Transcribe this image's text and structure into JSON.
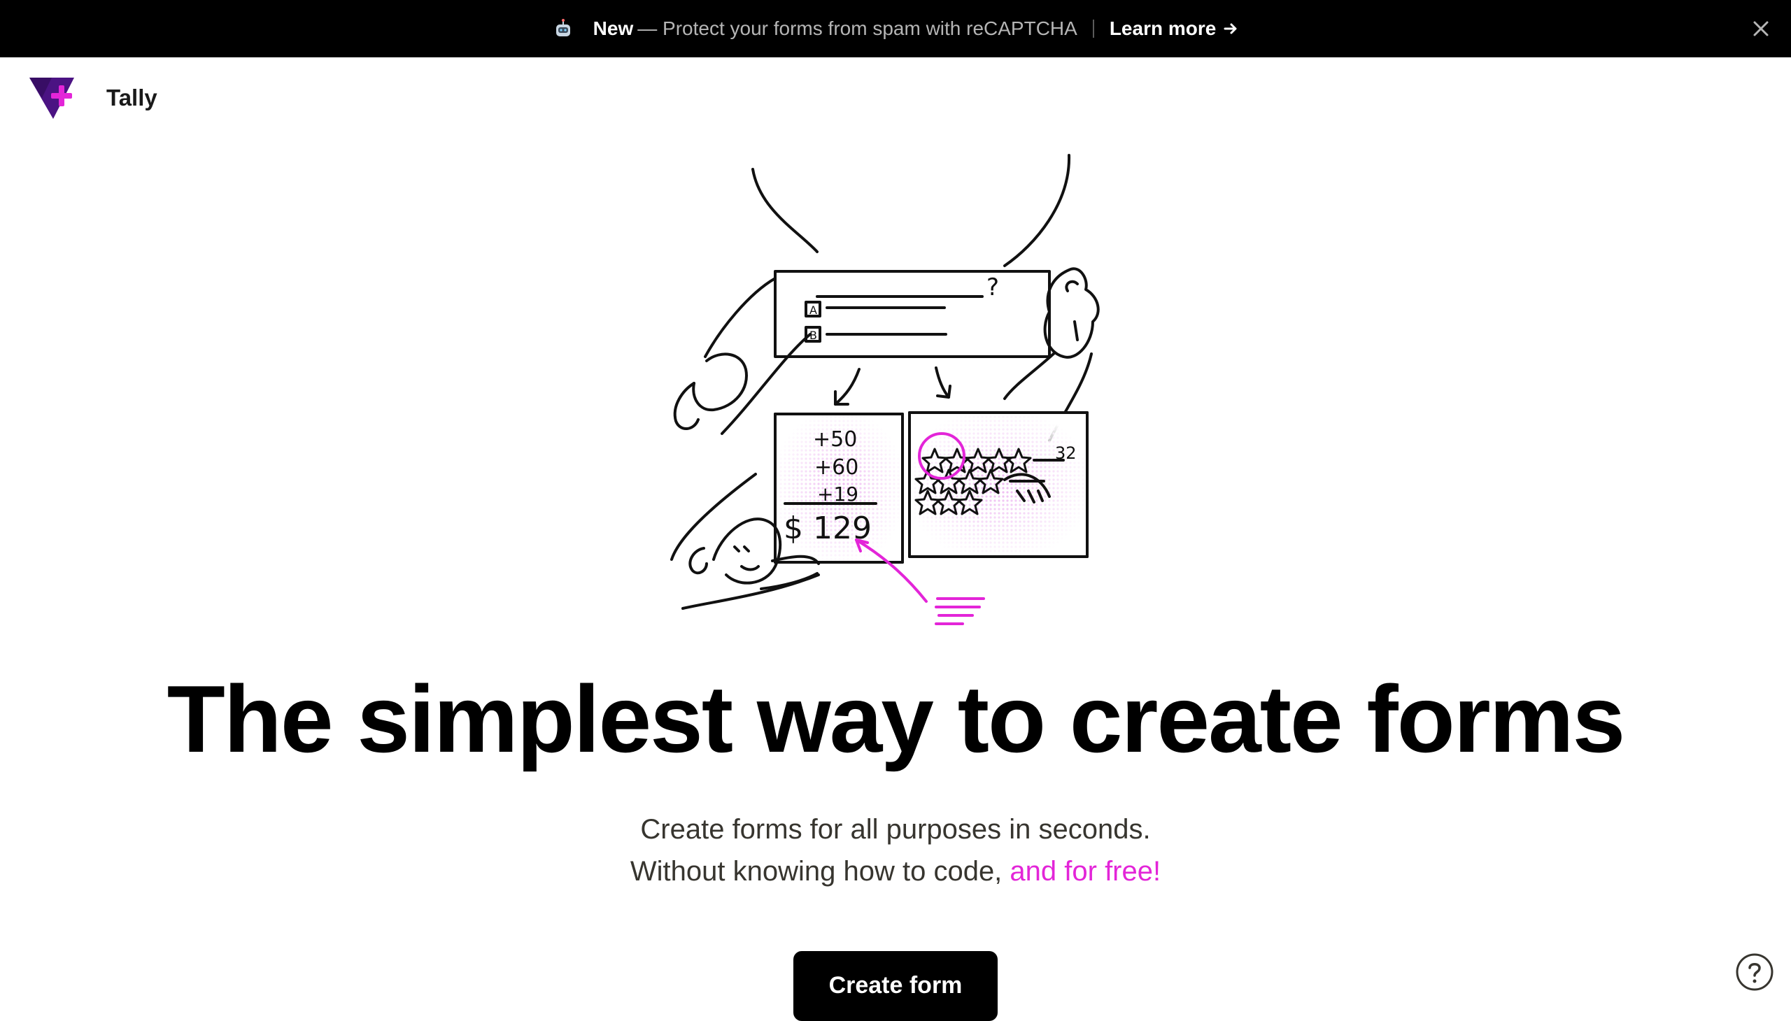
{
  "announcement": {
    "icon": "robot-icon",
    "new_label": "New",
    "text": "— Protect your forms from spam with reCAPTCHA",
    "learn_more": "Learn more",
    "close_icon": "close-icon"
  },
  "header": {
    "logo_icon": "tally-logo",
    "brand": "Tally"
  },
  "illustration": {
    "question_mark": "?",
    "option_a": "A",
    "option_b": "B",
    "sum_lines": [
      "+50",
      "+60",
      "+19"
    ],
    "total": "$ 129",
    "rating_count": "32"
  },
  "hero": {
    "headline": "The simplest way to create forms",
    "subline_1": "Create forms for all purposes in seconds.",
    "subline_2_prefix": "Without knowing how to code, ",
    "subline_2_highlight": "and for free!",
    "cta": "Create form"
  },
  "help": {
    "icon": "help-icon"
  },
  "colors": {
    "accent": "#e325d8",
    "brand_purple": "#4b1383",
    "bar_background": "#000000"
  }
}
